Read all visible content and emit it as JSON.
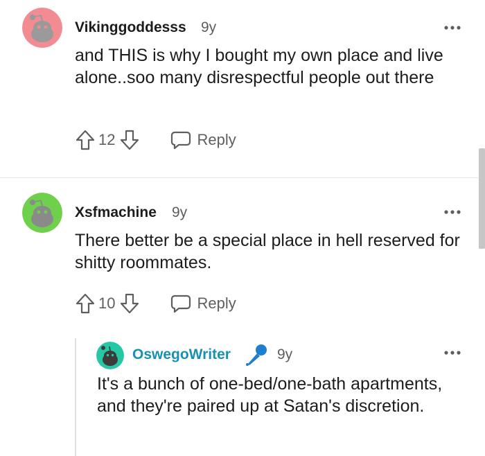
{
  "comments": [
    {
      "username": "Vikinggoddesss",
      "age": "9y",
      "body": "and THIS is why I bought my own place and live alone..soo many disrespectful people out there",
      "score": "12",
      "reply_label": "Reply",
      "avatar_color": "#f28b92"
    },
    {
      "username": "Xsfmachine",
      "age": "9y",
      "body": "There better be a special place in hell reserved for shitty roommates.",
      "score": "10",
      "reply_label": "Reply",
      "avatar_color": "#6fd14b"
    },
    {
      "username": "OswegoWriter",
      "age": "9y",
      "body": "It's a bunch of one-bed/one-bath apartments, and they're paired up at Satan's discretion.",
      "avatar_color": "#25c7a4",
      "flair_icon": "microphone-icon",
      "username_color": "#1a8fb5"
    }
  ],
  "icons": {
    "more": "more-options-icon",
    "upvote": "upvote-arrow-icon",
    "downvote": "downvote-arrow-icon",
    "reply": "speech-bubble-icon"
  },
  "colors": {
    "text": "#1c1c1c",
    "muted": "#5e5e5e",
    "flair": "#1e7fd0"
  }
}
